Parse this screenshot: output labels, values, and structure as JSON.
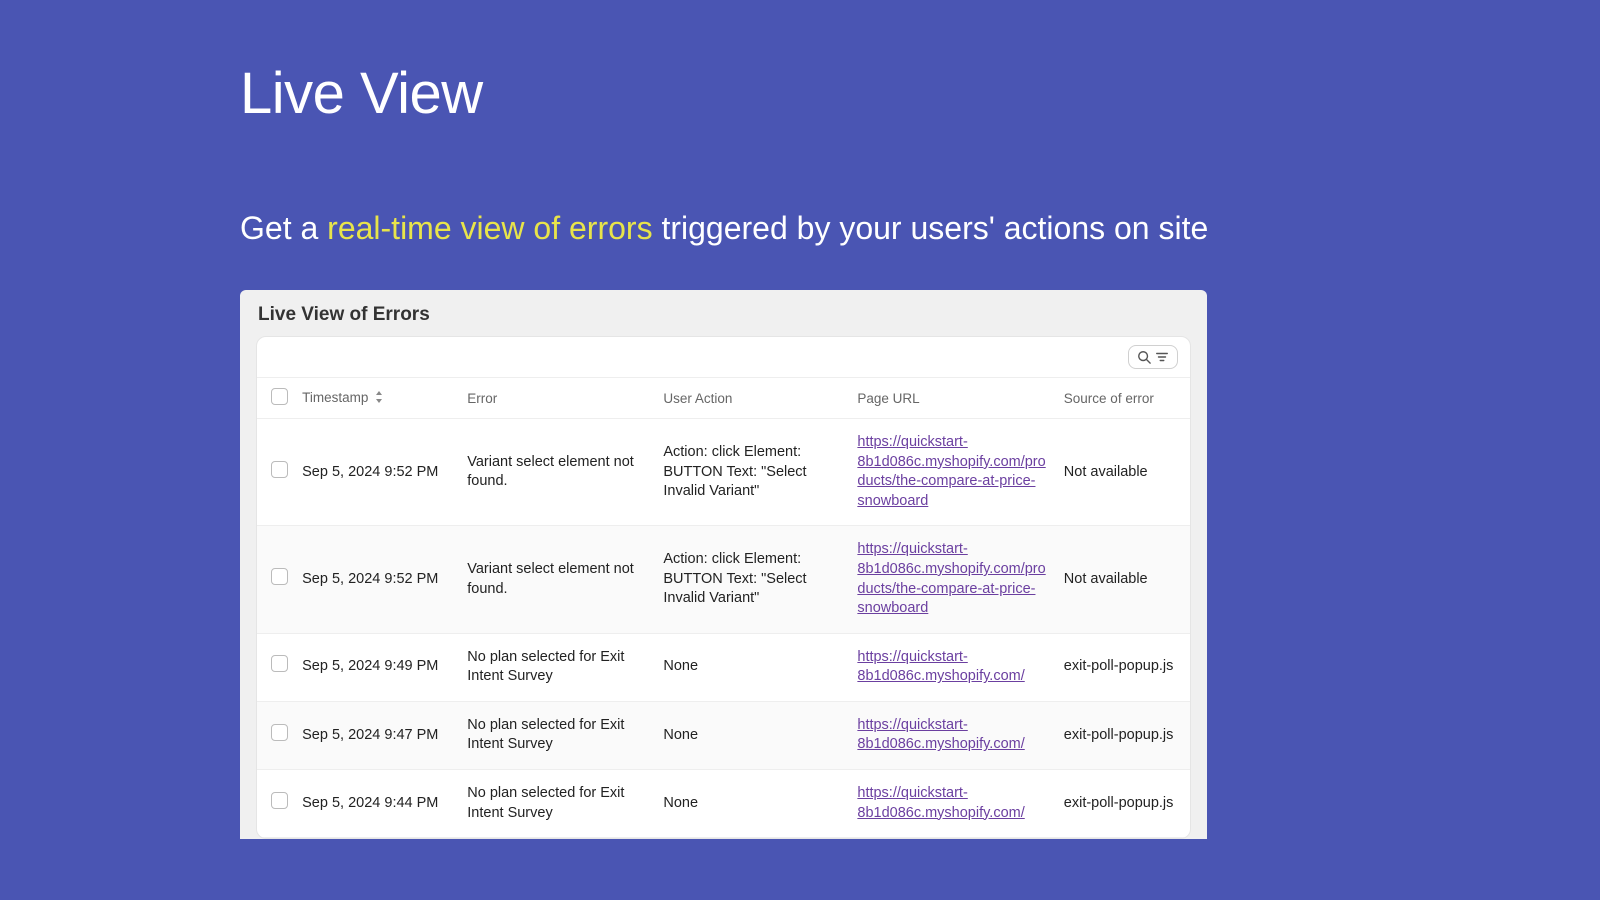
{
  "hero": {
    "title": "Live View",
    "sub_prefix": "Get a ",
    "sub_highlight": "real-time view of errors",
    "sub_suffix": " triggered by your users' actions on site"
  },
  "panel": {
    "title": "Live View of Errors"
  },
  "table": {
    "headers": {
      "timestamp": "Timestamp",
      "error": "Error",
      "user_action": "User Action",
      "page_url": "Page URL",
      "source": "Source of error"
    },
    "rows": [
      {
        "timestamp": "Sep 5, 2024 9:52 PM",
        "error": "Variant select element not found.",
        "user_action": "Action: click Element: BUTTON Text: \"Select Invalid Variant\"",
        "page_url": "https://quickstart-8b1d086c.myshopify.com/products/the-compare-at-price-snowboard",
        "source": "Not available"
      },
      {
        "timestamp": "Sep 5, 2024 9:52 PM",
        "error": "Variant select element not found.",
        "user_action": "Action: click Element: BUTTON Text: \"Select Invalid Variant\"",
        "page_url": "https://quickstart-8b1d086c.myshopify.com/products/the-compare-at-price-snowboard",
        "source": "Not available"
      },
      {
        "timestamp": "Sep 5, 2024 9:49 PM",
        "error": "No plan selected for Exit Intent Survey",
        "user_action": "None",
        "page_url": "https://quickstart-8b1d086c.myshopify.com/",
        "source": "exit-poll-popup.js"
      },
      {
        "timestamp": "Sep 5, 2024 9:47 PM",
        "error": "No plan selected for Exit Intent Survey",
        "user_action": "None",
        "page_url": "https://quickstart-8b1d086c.myshopify.com/",
        "source": "exit-poll-popup.js"
      },
      {
        "timestamp": "Sep 5, 2024 9:44 PM",
        "error": "No plan selected for Exit Intent Survey",
        "user_action": "None",
        "page_url": "https://quickstart-8b1d086c.myshopify.com/",
        "source": "exit-poll-popup.js"
      }
    ]
  }
}
